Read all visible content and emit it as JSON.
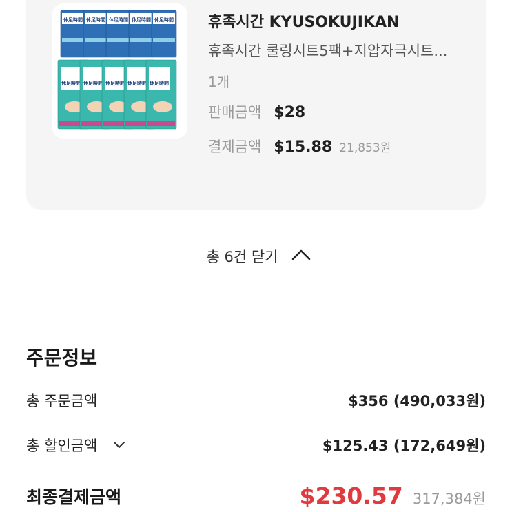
{
  "product": {
    "brand": "휴족시간 KYUSOKUJIKAN",
    "name": "휴족시간 쿨링시트5팩+지압자극시트...",
    "quantity": "1개",
    "price_label": "판매금액",
    "price_value": "$28",
    "payment_label": "결제금액",
    "payment_value": "$15.88",
    "payment_krw": "21,853원",
    "thumb_pack_top_text": "休足時間",
    "thumb_pack_bottom_text": "休足時間"
  },
  "toggle": {
    "label": "총 6건 닫기"
  },
  "order_info": {
    "title": "주문정보",
    "total_order_label": "총 주문금액",
    "total_order_value": "$356 (490,033원)",
    "total_discount_label": "총 할인금액",
    "total_discount_value": "$125.43 (172,649원)",
    "final_label": "최종결제금액",
    "final_value": "$230.57",
    "final_krw": "317,384원"
  },
  "colors": {
    "accent_red": "#e0393e",
    "card_bg": "#f5f5f5",
    "muted_text": "#9a9a9a"
  }
}
